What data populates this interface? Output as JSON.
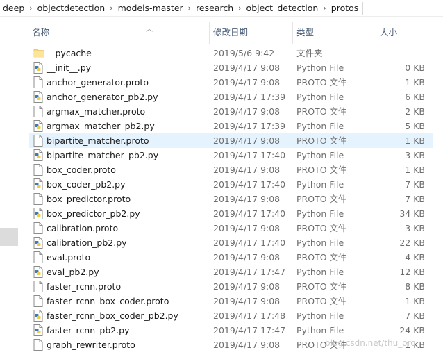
{
  "breadcrumb": [
    "deep",
    "objectdetection",
    "models-master",
    "research",
    "object_detection",
    "protos"
  ],
  "columns": {
    "name": "名称",
    "date": "修改日期",
    "type": "类型",
    "size": "大小"
  },
  "files": [
    {
      "name": "__pycache__",
      "date": "2019/5/6 9:42",
      "type": "文件夹",
      "size": "",
      "icon": "folder-icon"
    },
    {
      "name": "__init__.py",
      "date": "2019/4/17 9:08",
      "type": "Python File",
      "size": "0 KB",
      "icon": "python-file-icon"
    },
    {
      "name": "anchor_generator.proto",
      "date": "2019/4/17 9:08",
      "type": "PROTO 文件",
      "size": "1 KB",
      "icon": "blank-file-icon"
    },
    {
      "name": "anchor_generator_pb2.py",
      "date": "2019/4/17 17:39",
      "type": "Python File",
      "size": "6 KB",
      "icon": "python-file-icon"
    },
    {
      "name": "argmax_matcher.proto",
      "date": "2019/4/17 9:08",
      "type": "PROTO 文件",
      "size": "2 KB",
      "icon": "blank-file-icon"
    },
    {
      "name": "argmax_matcher_pb2.py",
      "date": "2019/4/17 17:39",
      "type": "Python File",
      "size": "5 KB",
      "icon": "python-file-icon"
    },
    {
      "name": "bipartite_matcher.proto",
      "date": "2019/4/17 9:08",
      "type": "PROTO 文件",
      "size": "1 KB",
      "icon": "blank-file-icon",
      "selected": true
    },
    {
      "name": "bipartite_matcher_pb2.py",
      "date": "2019/4/17 17:40",
      "type": "Python File",
      "size": "3 KB",
      "icon": "python-file-icon"
    },
    {
      "name": "box_coder.proto",
      "date": "2019/4/17 9:08",
      "type": "PROTO 文件",
      "size": "1 KB",
      "icon": "blank-file-icon"
    },
    {
      "name": "box_coder_pb2.py",
      "date": "2019/4/17 17:40",
      "type": "Python File",
      "size": "7 KB",
      "icon": "python-file-icon"
    },
    {
      "name": "box_predictor.proto",
      "date": "2019/4/17 9:08",
      "type": "PROTO 文件",
      "size": "7 KB",
      "icon": "blank-file-icon"
    },
    {
      "name": "box_predictor_pb2.py",
      "date": "2019/4/17 17:40",
      "type": "Python File",
      "size": "34 KB",
      "icon": "python-file-icon"
    },
    {
      "name": "calibration.proto",
      "date": "2019/4/17 9:08",
      "type": "PROTO 文件",
      "size": "3 KB",
      "icon": "blank-file-icon"
    },
    {
      "name": "calibration_pb2.py",
      "date": "2019/4/17 17:40",
      "type": "Python File",
      "size": "22 KB",
      "icon": "python-file-icon"
    },
    {
      "name": "eval.proto",
      "date": "2019/4/17 9:08",
      "type": "PROTO 文件",
      "size": "4 KB",
      "icon": "blank-file-icon"
    },
    {
      "name": "eval_pb2.py",
      "date": "2019/4/17 17:47",
      "type": "Python File",
      "size": "12 KB",
      "icon": "python-file-icon"
    },
    {
      "name": "faster_rcnn.proto",
      "date": "2019/4/17 9:08",
      "type": "PROTO 文件",
      "size": "8 KB",
      "icon": "blank-file-icon"
    },
    {
      "name": "faster_rcnn_box_coder.proto",
      "date": "2019/4/17 9:08",
      "type": "PROTO 文件",
      "size": "1 KB",
      "icon": "blank-file-icon"
    },
    {
      "name": "faster_rcnn_box_coder_pb2.py",
      "date": "2019/4/17 17:48",
      "type": "Python File",
      "size": "7 KB",
      "icon": "python-file-icon"
    },
    {
      "name": "faster_rcnn_pb2.py",
      "date": "2019/4/17 17:47",
      "type": "Python File",
      "size": "24 KB",
      "icon": "python-file-icon"
    },
    {
      "name": "graph_rewriter.proto",
      "date": "2019/4/17 9:08",
      "type": "PROTO 文件",
      "size": "1 KB",
      "icon": "blank-file-icon"
    }
  ],
  "watermark": "blog.csdn.net/thu_oro",
  "colors": {
    "selected_row": "#e5f3ff",
    "folder": "#f8d775",
    "header_text": "#4c607a"
  }
}
